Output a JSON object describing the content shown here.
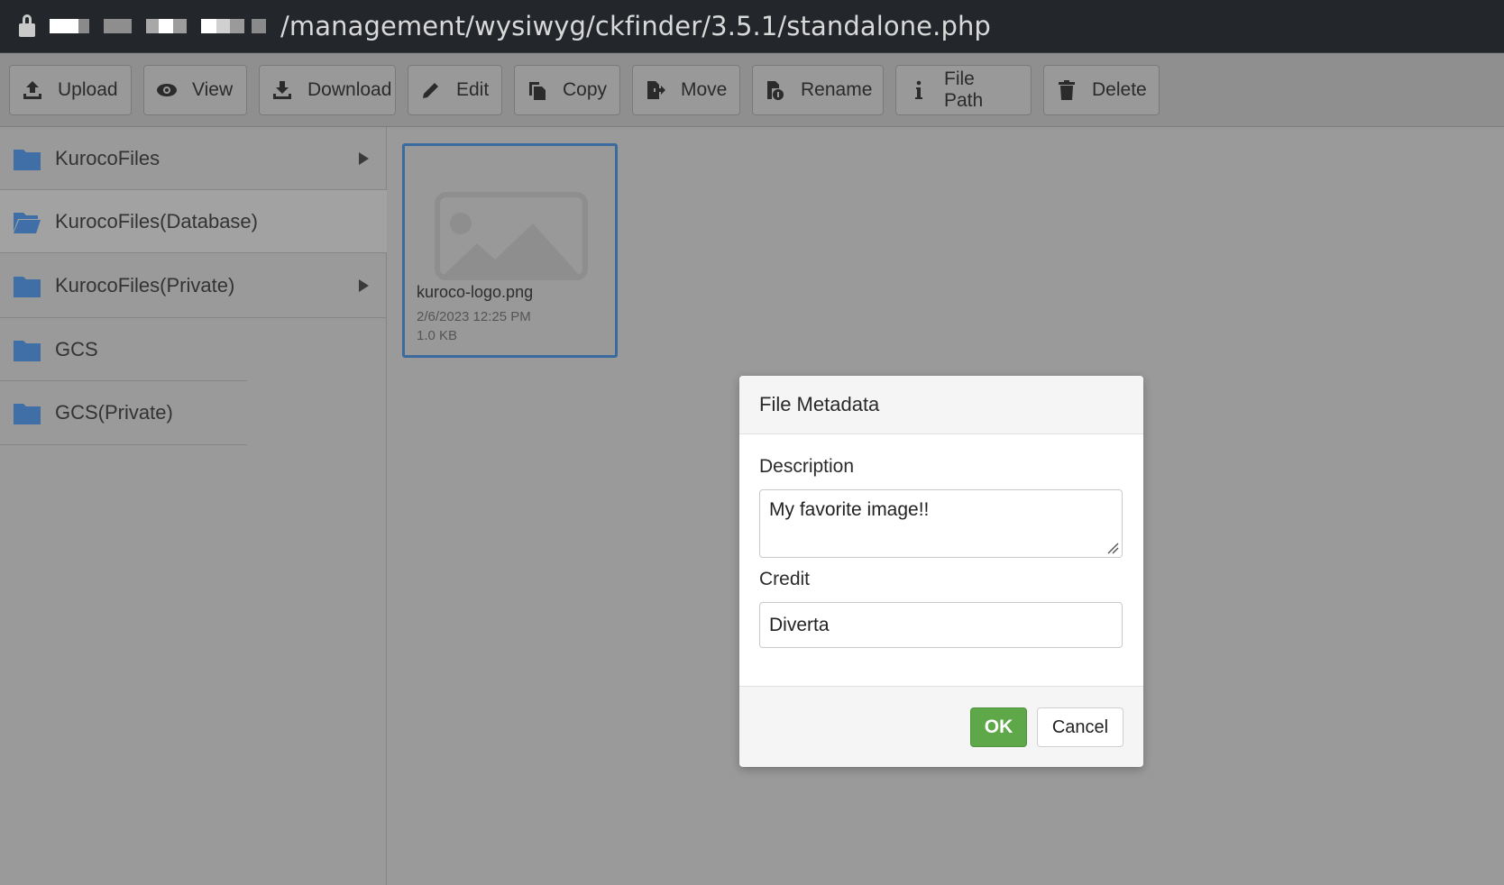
{
  "address_bar": {
    "url_path": "/management/wysiwyg/ckfinder/3.5.1/standalone.php"
  },
  "toolbar": {
    "buttons": [
      {
        "label": "Upload",
        "icon": "upload-icon"
      },
      {
        "label": "View",
        "icon": "eye-icon"
      },
      {
        "label": "Download",
        "icon": "download-icon"
      },
      {
        "label": "Edit",
        "icon": "pencil-icon"
      },
      {
        "label": "Copy",
        "icon": "copy-icon"
      },
      {
        "label": "Move",
        "icon": "move-icon"
      },
      {
        "label": "Rename",
        "icon": "rename-icon"
      },
      {
        "label": "File Path",
        "icon": "info-icon"
      },
      {
        "label": "Delete",
        "icon": "trash-icon"
      }
    ]
  },
  "sidebar": {
    "folders": [
      {
        "label": "KurocoFiles",
        "has_children": true
      },
      {
        "label": "KurocoFiles(Database)",
        "has_children": false
      },
      {
        "label": "KurocoFiles(Private)",
        "has_children": true
      },
      {
        "label": "GCS",
        "has_children": false
      },
      {
        "label": "GCS(Private)",
        "has_children": false
      }
    ]
  },
  "files": [
    {
      "name": "kuroco-logo.png",
      "date": "2/6/2023 12:25 PM",
      "size": "1.0 KB"
    }
  ],
  "dialog": {
    "title": "File Metadata",
    "description_label": "Description",
    "description_value": "My favorite image!!",
    "credit_label": "Credit",
    "credit_value": "Diverta",
    "ok_label": "OK",
    "cancel_label": "Cancel"
  },
  "colors": {
    "accent_blue": "#3b6a9e",
    "folder_blue": "#3f6fa6",
    "ok_green": "#5fa84a"
  }
}
